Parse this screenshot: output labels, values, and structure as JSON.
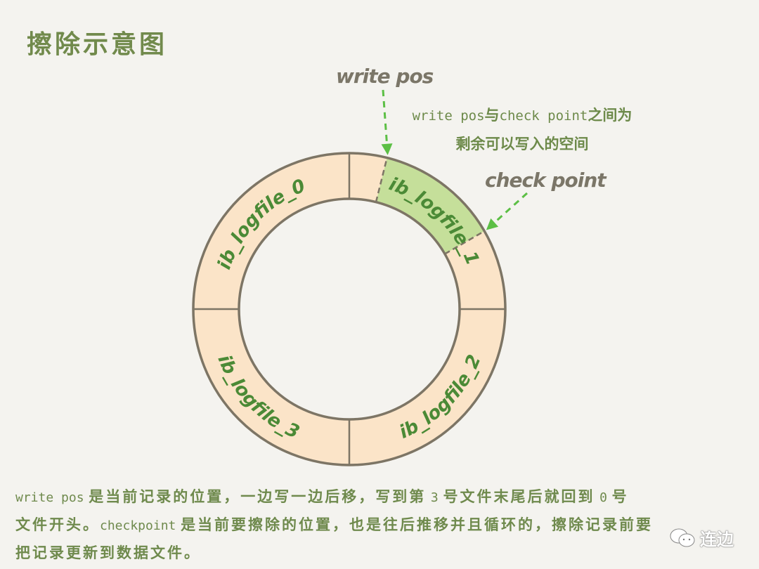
{
  "title": "擦除示意图",
  "pointers": {
    "write_pos": "write pos",
    "check_point": "check point"
  },
  "annotation": {
    "line1_latin_a": "write pos",
    "line1_cjk_a": "与",
    "line1_latin_b": "check point",
    "line1_cjk_b": "之间为",
    "line2": "剩余可以写入的空间"
  },
  "ring": {
    "segments": [
      {
        "label": "ib_logfile_0",
        "state": "normal"
      },
      {
        "label": "ib_logfile_1",
        "state": "partially-free"
      },
      {
        "label": "ib_logfile_2",
        "state": "normal"
      },
      {
        "label": "ib_logfile_3",
        "state": "normal"
      }
    ],
    "colors": {
      "segment_fill": "#fbe4c8",
      "free_space_fill": "#c5df9a",
      "outline": "#7d7565",
      "label_text": "#4b8a36",
      "arrow": "#5cbf45"
    }
  },
  "description": {
    "p1_latin": "write pos",
    "p1_cjk": "是当前记录的位置，一边写一边后移，写到第",
    "p1_num1": "3",
    "p1_cjk2": "号文件末尾后就回到",
    "p1_num2": "0",
    "p1_cjk3": "号",
    "p2_cjk": "文件开头。",
    "p2_latin": "checkpoint",
    "p2_cjk2": "是当前要擦除的位置，也是往后推移并且循环的，擦除记录前要",
    "p3_cjk": "把记录更新到数据文件。"
  },
  "watermark": {
    "icon": "wechat-icon",
    "text": "连边"
  }
}
